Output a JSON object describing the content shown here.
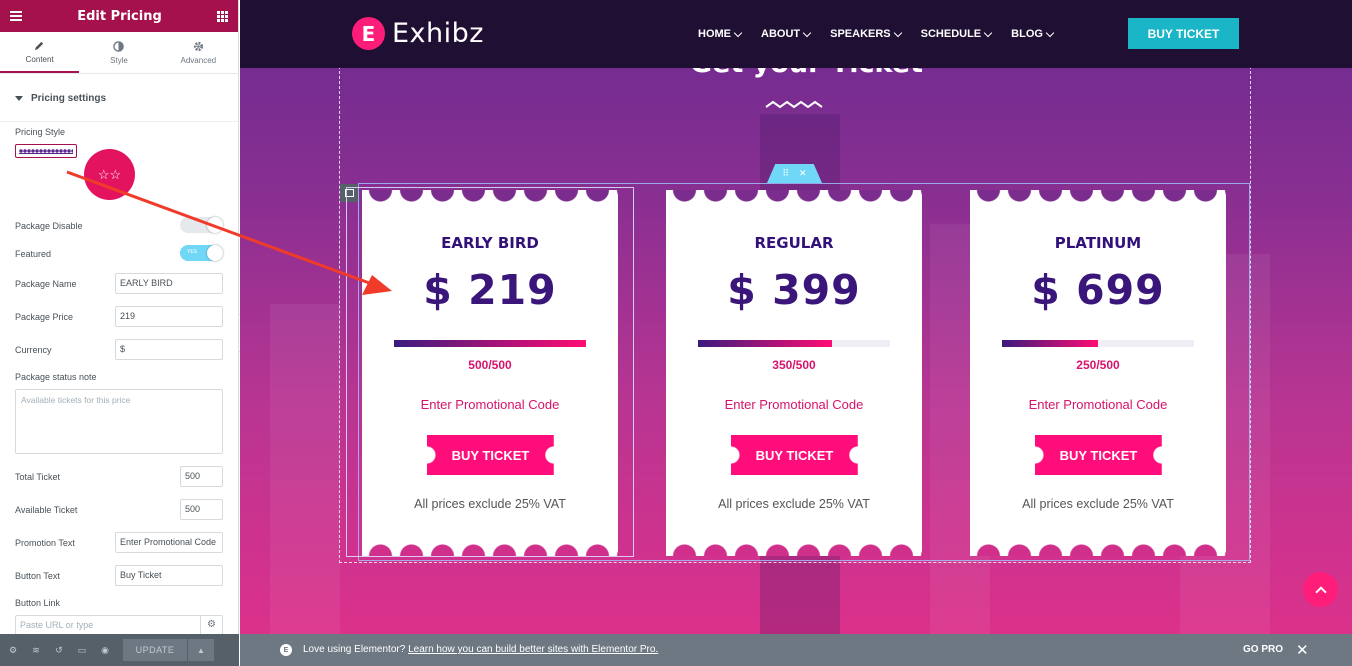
{
  "panel": {
    "title": "Edit Pricing",
    "tabs": [
      {
        "label": "Content"
      },
      {
        "label": "Style"
      },
      {
        "label": "Advanced"
      }
    ],
    "section": "Pricing settings",
    "fields": {
      "pricing_style": "Pricing Style",
      "package_disable": "Package Disable",
      "featured": "Featured",
      "featured_on": "YES",
      "package_name_label": "Package Name",
      "package_name_value": "EARLY BIRD",
      "package_price_label": "Package Price",
      "package_price_value": "219",
      "currency_label": "Currency",
      "currency_value": "$",
      "status_note_label": "Package status note",
      "status_note_placeholder": "Available tickets for this price",
      "total_ticket_label": "Total Ticket",
      "total_ticket_value": "500",
      "available_ticket_label": "Available Ticket",
      "available_ticket_value": "500",
      "promotion_text_label": "Promotion Text",
      "promotion_text_value": "Enter Promotional Code",
      "button_text_label": "Button Text",
      "button_text_value": "Buy Ticket",
      "button_link_label": "Button Link",
      "button_link_placeholder": "Paste URL or type"
    },
    "footer": {
      "update": "UPDATE"
    }
  },
  "site": {
    "logo_text": "Exhibz",
    "logo_letter": "E",
    "nav": [
      "HOME",
      "ABOUT",
      "SPEAKERS",
      "SCHEDULE",
      "BLOG"
    ],
    "buy_ticket": "BUY TICKET",
    "heading": "Get your Ticket"
  },
  "cards": [
    {
      "name": "EARLY BIRD",
      "price": "$ 219",
      "count": "500/500",
      "fill": 1.0,
      "promo": "Enter Promotional Code",
      "button": "BUY TICKET",
      "vat": "All prices exclude 25% VAT"
    },
    {
      "name": "REGULAR",
      "price": "$ 399",
      "count": "350/500",
      "fill": 0.7,
      "promo": "Enter Promotional Code",
      "button": "BUY TICKET",
      "vat": "All prices exclude 25% VAT"
    },
    {
      "name": "PLATINUM",
      "price": "$ 699",
      "count": "250/500",
      "fill": 0.5,
      "promo": "Enter Promotional Code",
      "button": "BUY TICKET",
      "vat": "All prices exclude 25% VAT"
    }
  ],
  "promo_bar": {
    "lead": "Love using Elementor?",
    "link": "Learn how you can build better sites with Elementor Pro.",
    "go_pro": "GO PRO"
  },
  "colors": {
    "panel_accent": "#a4114c",
    "brand_pink": "#ff0d7a",
    "topbar": "#1e0f33",
    "cyan": "#1ab5c6",
    "arrow": "#f03a2a"
  }
}
